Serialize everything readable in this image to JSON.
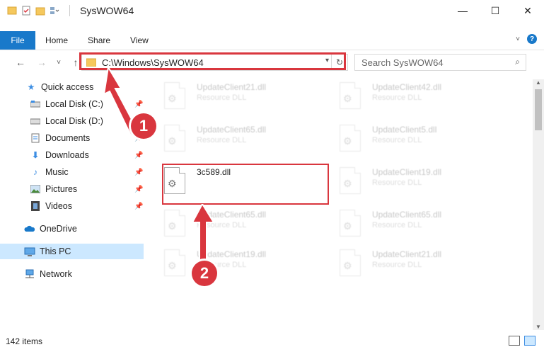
{
  "window": {
    "title": "SysWOW64",
    "minimize": "—",
    "maximize": "☐",
    "close": "✕"
  },
  "ribbon": {
    "file": "File",
    "tabs": [
      "Home",
      "Share",
      "View"
    ]
  },
  "nav": {
    "back": "←",
    "forward": "→",
    "recent": "˅",
    "up": "↑",
    "address": "C:\\Windows\\SysWOW64",
    "refresh": "↻",
    "search_placeholder": "Search SysWOW64"
  },
  "sidebar": {
    "items": [
      {
        "label": "Quick access",
        "icon": "star-icon",
        "pinned": false
      },
      {
        "label": "Local Disk (C:)",
        "icon": "drive-icon",
        "pinned": true
      },
      {
        "label": "Local Disk (D:)",
        "icon": "drive-icon",
        "pinned": true
      },
      {
        "label": "Documents",
        "icon": "documents-icon",
        "pinned": true
      },
      {
        "label": "Downloads",
        "icon": "download-icon",
        "pinned": true
      },
      {
        "label": "Music",
        "icon": "music-icon",
        "pinned": true
      },
      {
        "label": "Pictures",
        "icon": "pictures-icon",
        "pinned": true
      },
      {
        "label": "Videos",
        "icon": "videos-icon",
        "pinned": true
      },
      {
        "label": "OneDrive",
        "icon": "cloud-icon",
        "pinned": false
      },
      {
        "label": "This PC",
        "icon": "computer-icon",
        "pinned": false,
        "selected": true
      },
      {
        "label": "Network",
        "icon": "network-icon",
        "pinned": false
      }
    ]
  },
  "files": [
    {
      "name": "UpdateClient21.dll",
      "type": "Resource DLL",
      "faded": true
    },
    {
      "name": "UpdateClient42.dll",
      "type": "Resource DLL",
      "faded": true
    },
    {
      "name": "UpdateClient65.dll",
      "type": "Resource DLL",
      "faded": true
    },
    {
      "name": "UpdateClient5.dll",
      "type": "Resource DLL",
      "faded": true
    },
    {
      "name": "3c589.dll",
      "type": "",
      "faded": false
    },
    {
      "name": "UpdateClient19.dll",
      "type": "Resource DLL",
      "faded": true
    },
    {
      "name": "UpdateClient65.dll",
      "type": "Resource DLL",
      "faded": true
    },
    {
      "name": "UpdateClient65.dll",
      "type": "Resource DLL",
      "faded": true
    },
    {
      "name": "UpdateClient19.dll",
      "type": "Resource DLL",
      "faded": true
    },
    {
      "name": "UpdateClient21.dll",
      "type": "Resource DLL",
      "faded": true
    }
  ],
  "status": {
    "item_count": "142 items"
  },
  "annotations": {
    "step1": "1",
    "step2": "2"
  },
  "colors": {
    "accent": "#1979ca",
    "highlight": "#d9363e",
    "selected": "#cce8ff"
  }
}
